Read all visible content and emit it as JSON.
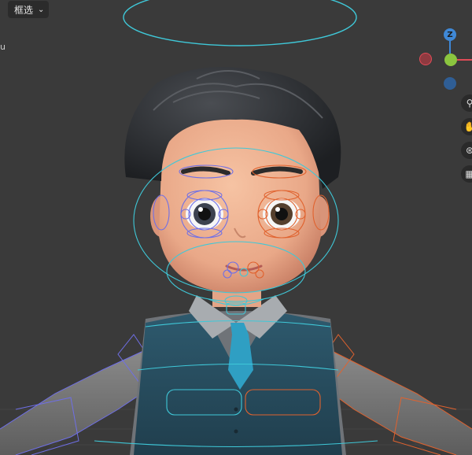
{
  "header": {
    "left_fragment": ".",
    "select_mode_label": "框选",
    "dropdown_icon": "chevron-down-icon"
  },
  "viewport": {
    "view_label": "u"
  },
  "gizmo": {
    "z_label": "Z",
    "colors": {
      "x": "#e04b57",
      "y": "#8bc53f",
      "z": "#3f88d6",
      "x_neg": "#8f3a40",
      "z_neg": "#2f5e95"
    }
  },
  "nav_tools": [
    {
      "icon": "zoom-icon",
      "glyph": "⚲"
    },
    {
      "icon": "pan-icon",
      "glyph": "✋"
    },
    {
      "icon": "camera-icon",
      "glyph": "⊛"
    },
    {
      "icon": "grid-icon",
      "glyph": "▦"
    }
  ]
}
